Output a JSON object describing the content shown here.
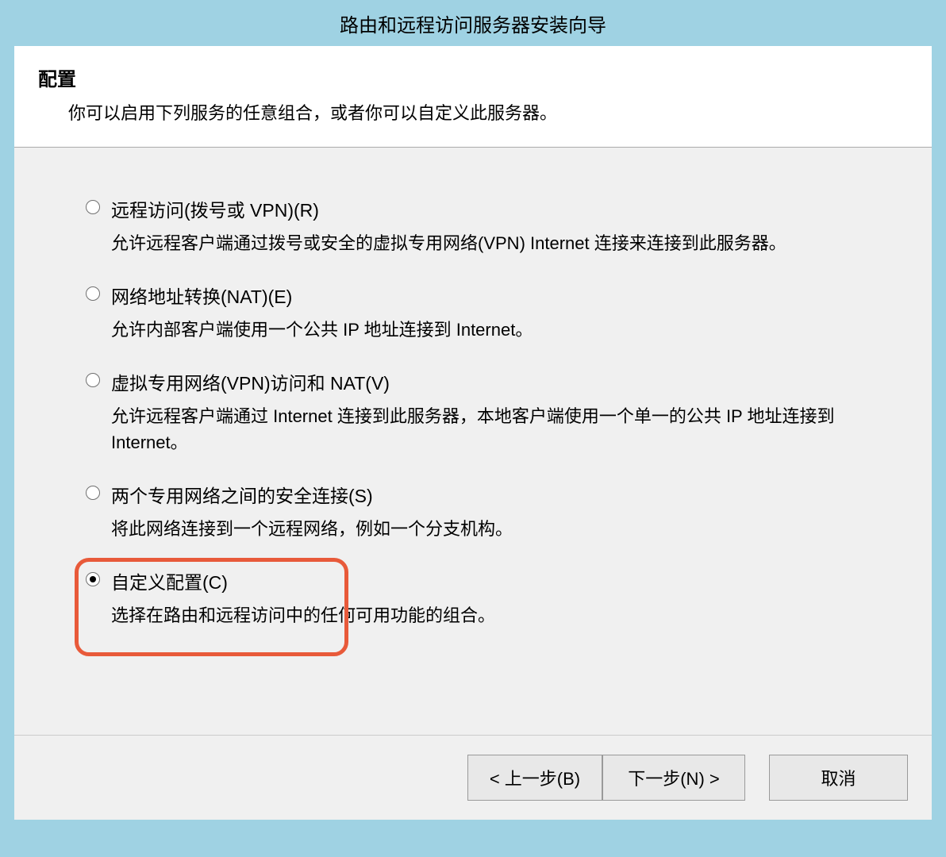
{
  "window": {
    "title": "路由和远程访问服务器安装向导"
  },
  "header": {
    "title": "配置",
    "subtitle": "你可以启用下列服务的任意组合，或者你可以自定义此服务器。"
  },
  "options": [
    {
      "label": "远程访问(拨号或 VPN)(R)",
      "description": "允许远程客户端通过拨号或安全的虚拟专用网络(VPN) Internet 连接来连接到此服务器。",
      "selected": false
    },
    {
      "label": "网络地址转换(NAT)(E)",
      "description": "允许内部客户端使用一个公共 IP 地址连接到 Internet。",
      "selected": false
    },
    {
      "label": "虚拟专用网络(VPN)访问和 NAT(V)",
      "description": "允许远程客户端通过 Internet 连接到此服务器，本地客户端使用一个单一的公共 IP 地址连接到 Internet。",
      "selected": false
    },
    {
      "label": "两个专用网络之间的安全连接(S)",
      "description": "将此网络连接到一个远程网络，例如一个分支机构。",
      "selected": false
    },
    {
      "label": "自定义配置(C)",
      "description": "选择在路由和远程访问中的任何可用功能的组合。",
      "selected": true
    }
  ],
  "buttons": {
    "back": "< 上一步(B)",
    "next": "下一步(N) >",
    "cancel": "取消"
  }
}
